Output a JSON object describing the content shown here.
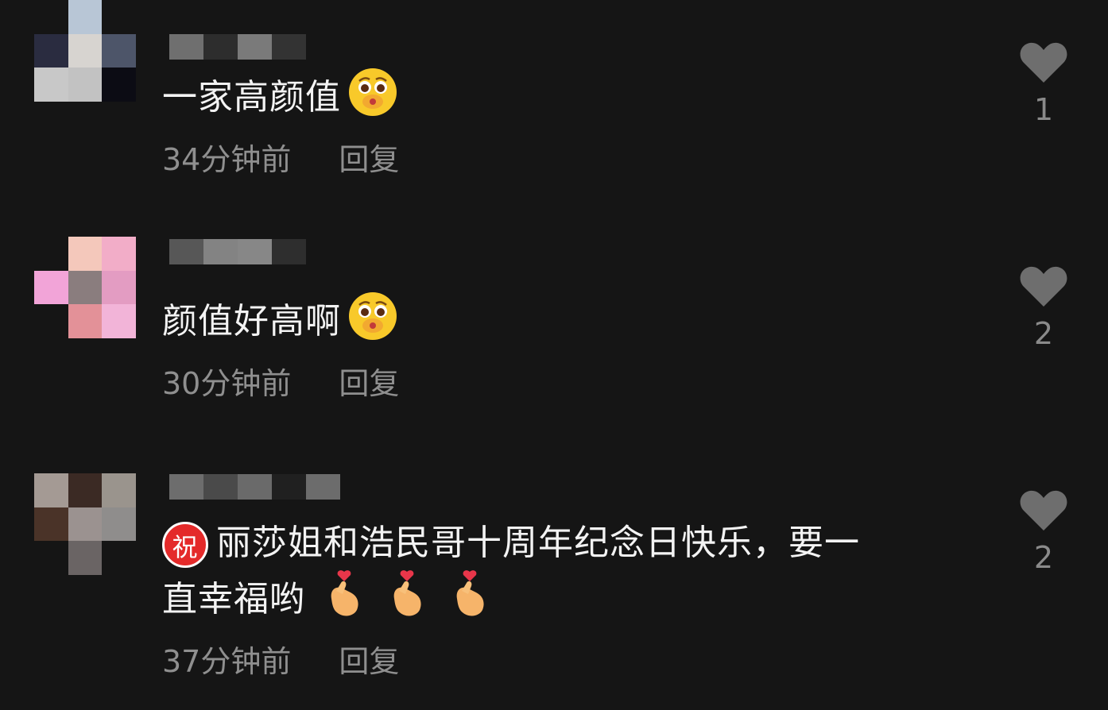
{
  "comments": [
    {
      "text": "一家高颜值",
      "time": "34分钟前",
      "reply": "回复",
      "likes": "1",
      "emoji": "face-hand-over-mouth-icon",
      "avatar_colors": [
        "#151515",
        "#b8c6d6",
        "#151515",
        "#2a2c40",
        "#d7d4d0",
        "#4d5569",
        "#c8c8c8",
        "#c2c2c2",
        "#0c0c14"
      ],
      "username_colors": [
        "#6f6f6f",
        "#2d2d2d",
        "#7a7a7a",
        "#333333"
      ]
    },
    {
      "text": "颜值好高啊",
      "time": "30分钟前",
      "reply": "回复",
      "likes": "2",
      "emoji": "face-hand-over-mouth-icon",
      "avatar_colors": [
        "#151515",
        "#f4c8bb",
        "#f2adc8",
        "#f2a4d8",
        "#8a7d7e",
        "#e39cc2",
        "#151515",
        "#e39198",
        "#f2b4d8"
      ],
      "username_colors": [
        "#575757",
        "#838383",
        "#878787",
        "#2e2e2e"
      ]
    },
    {
      "badge": "祝",
      "text": "丽莎姐和浩民哥十周年纪念日快乐，要一",
      "text2": "直幸福哟",
      "time": "37分钟前",
      "reply": "回复",
      "likes": "2",
      "emoji": "finger-heart-icon",
      "avatar_colors": [
        "#a49a94",
        "#3b2a24",
        "#9a948d",
        "#4a3328",
        "#9b9290",
        "#8f8d8c",
        "#151515",
        "#6a6464",
        "#151515"
      ],
      "username_colors": [
        "#6d6d6d",
        "#4a4a4a",
        "#6a6a6a",
        "#202020",
        "#6c6c6c"
      ]
    }
  ]
}
